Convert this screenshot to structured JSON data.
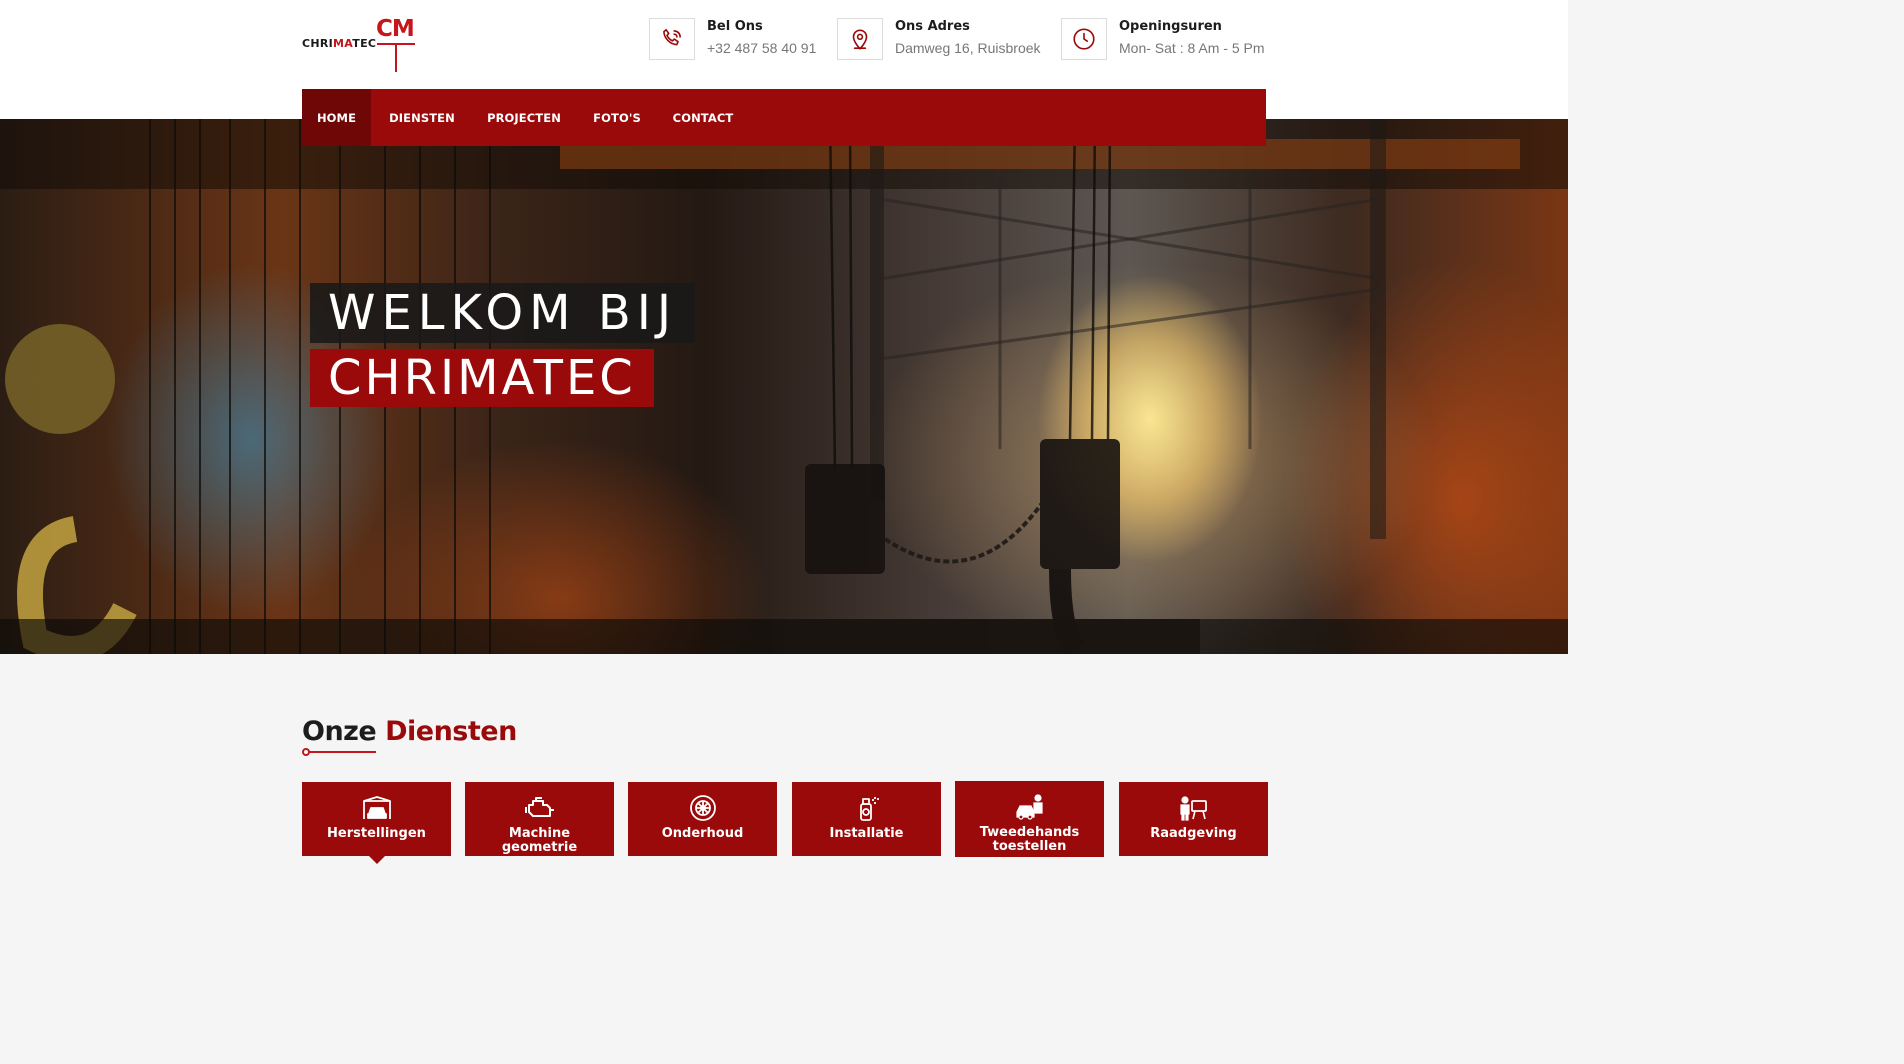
{
  "brand": {
    "logo_small": "CHRIMATEC",
    "logo_small_red_part": "MA",
    "logo_mark": "CM"
  },
  "contact": [
    {
      "icon": "phone-icon",
      "title": "Bel Ons",
      "value": "+32 487 58 40 91"
    },
    {
      "icon": "location-pin-icon",
      "title": "Ons Adres",
      "value": "Damweg 16, Ruisbroek"
    },
    {
      "icon": "clock-icon",
      "title": "Openingsuren",
      "value": "Mon- Sat : 8 Am - 5 Pm"
    }
  ],
  "nav": {
    "items": [
      {
        "label": "HOME",
        "active": true
      },
      {
        "label": "DIENSTEN",
        "active": false
      },
      {
        "label": "PROJECTEN",
        "active": false
      },
      {
        "label": "FOTO'S",
        "active": false
      },
      {
        "label": "CONTACT",
        "active": false
      }
    ]
  },
  "hero": {
    "line1": "WELKOM BIJ",
    "line2": "CHRIMATEC"
  },
  "services": {
    "title_plain": "Onze",
    "title_accent": "Diensten",
    "items": [
      {
        "label": "Herstellingen",
        "icon": "garage-car-icon",
        "selected": true
      },
      {
        "label": "Machine geometrie",
        "icon": "engine-icon",
        "selected": false
      },
      {
        "label": "Onderhoud",
        "icon": "wheel-icon",
        "selected": false
      },
      {
        "label": "Installatie",
        "icon": "spray-can-icon",
        "selected": false
      },
      {
        "label": "Tweedehands toestellen",
        "icon": "car-seller-icon",
        "selected": false
      },
      {
        "label": "Raadgeving",
        "icon": "consulting-icon",
        "selected": false
      }
    ]
  },
  "colors": {
    "brand_red": "#9a0a0a",
    "brand_red_dark": "#6f0707",
    "logo_red": "#c4161c"
  }
}
